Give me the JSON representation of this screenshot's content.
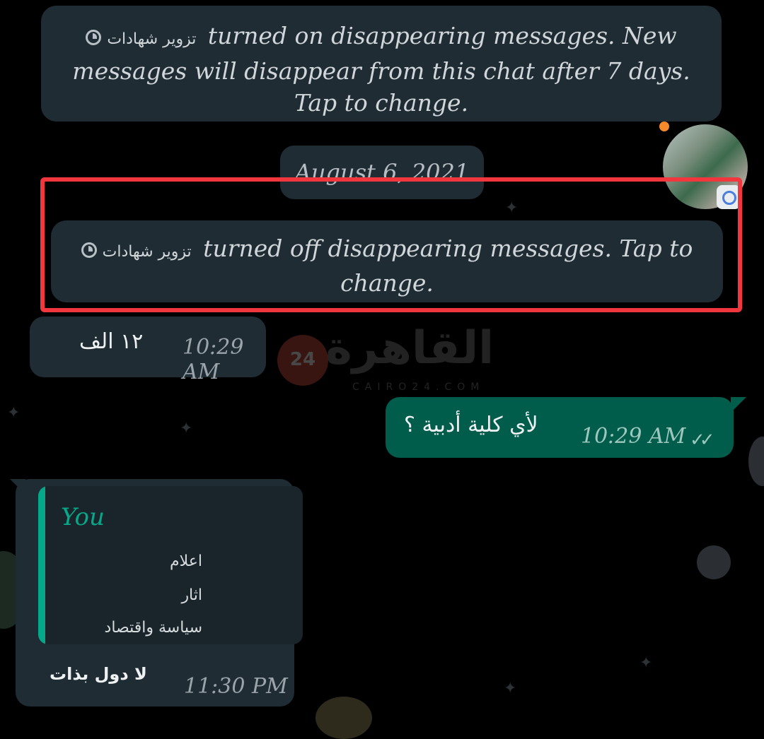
{
  "system_messages": [
    {
      "sender": "تزوير شهادات",
      "text": "turned on disappearing messages. New messages will disappear from this chat after 7 days. Tap to change."
    },
    {
      "sender": "تزوير شهادات",
      "text": "turned off disappearing messages. Tap to change."
    }
  ],
  "date_separator": "August 6, 2021",
  "messages": [
    {
      "direction": "incoming",
      "text": "١٢ الف",
      "time": "10:29 AM"
    },
    {
      "direction": "outgoing",
      "text": "لأي كلية أدبية ؟",
      "time": "10:29 AM",
      "status_icon": "double-check-icon"
    },
    {
      "direction": "incoming",
      "quote": {
        "author": "You",
        "lines": [
          "اعلام",
          "اثار",
          "سياسة واقتصاد"
        ]
      },
      "text": "لا دول بذات",
      "time": "11:30 PM"
    }
  ],
  "watermark": {
    "text": "القاهرة",
    "number": "24",
    "subtitle": "CAIRO24.COM"
  },
  "colors": {
    "highlight": "#f2363d",
    "outgoing_bubble": "#005c4b",
    "incoming_bubble": "#1f2c33",
    "quote_accent": "#06a88a"
  }
}
